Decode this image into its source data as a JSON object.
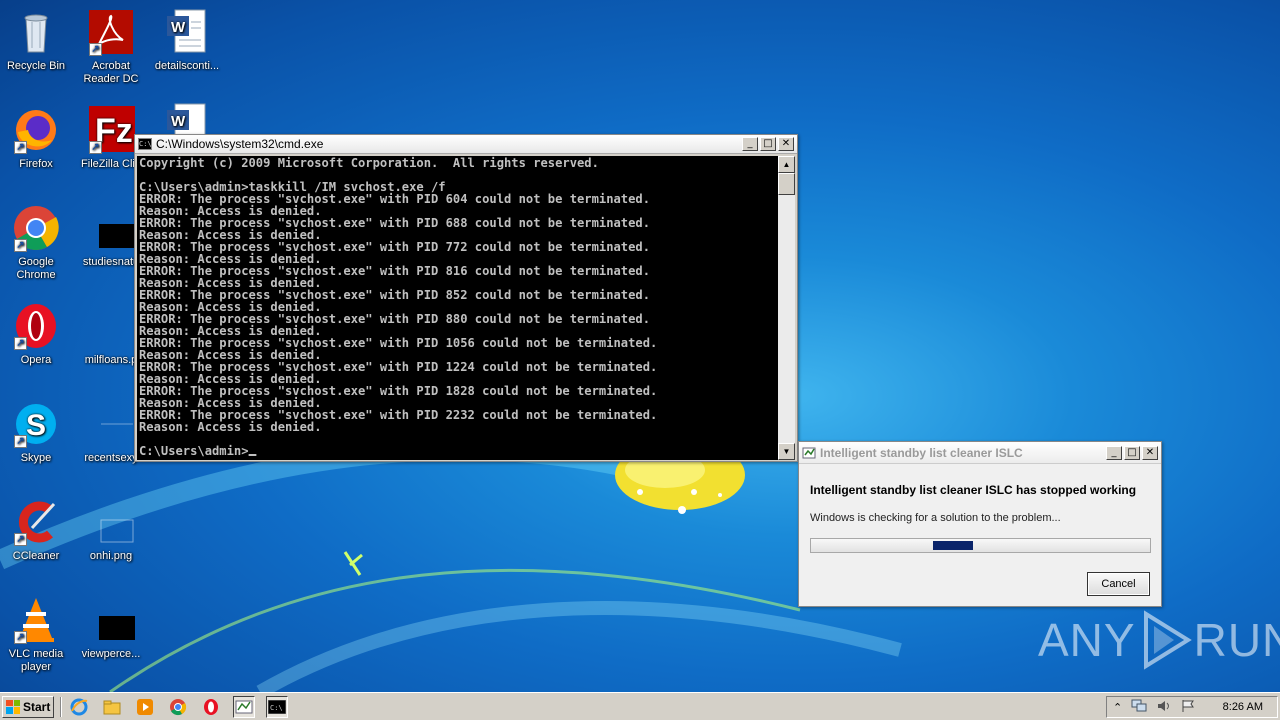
{
  "desktop": {
    "icons": [
      {
        "label": "Recycle Bin",
        "icon": "recycle-bin-icon"
      },
      {
        "label": "Acrobat Reader DC",
        "icon": "acrobat-icon"
      },
      {
        "label": "detailsconti...",
        "icon": "word-doc-icon"
      },
      {
        "label": "Firefox",
        "icon": "firefox-icon"
      },
      {
        "label": "FileZilla Clie",
        "icon": "filezilla-icon"
      },
      {
        "label": "Google Chrome",
        "icon": "chrome-icon"
      },
      {
        "label": "studiesnatu",
        "icon": "file-icon"
      },
      {
        "label": "Opera",
        "icon": "opera-icon"
      },
      {
        "label": "milfloans.p",
        "icon": "file-icon"
      },
      {
        "label": "Skype",
        "icon": "skype-icon"
      },
      {
        "label": "recentsexy",
        "icon": "file-icon"
      },
      {
        "label": "CCleaner",
        "icon": "ccleaner-icon"
      },
      {
        "label": "onhi.png",
        "icon": "image-file-icon"
      },
      {
        "label": "VLC media player",
        "icon": "vlc-icon"
      },
      {
        "label": "viewperce...",
        "icon": "file-icon"
      }
    ]
  },
  "cmd_window": {
    "title": "C:\\Windows\\system32\\cmd.exe",
    "lines": [
      "Copyright (c) 2009 Microsoft Corporation.  All rights reserved.",
      "",
      "C:\\Users\\admin>taskkill /IM svchost.exe /f",
      "ERROR: The process \"svchost.exe\" with PID 604 could not be terminated.",
      "Reason: Access is denied.",
      "ERROR: The process \"svchost.exe\" with PID 688 could not be terminated.",
      "Reason: Access is denied.",
      "ERROR: The process \"svchost.exe\" with PID 772 could not be terminated.",
      "Reason: Access is denied.",
      "ERROR: The process \"svchost.exe\" with PID 816 could not be terminated.",
      "Reason: Access is denied.",
      "ERROR: The process \"svchost.exe\" with PID 852 could not be terminated.",
      "Reason: Access is denied.",
      "ERROR: The process \"svchost.exe\" with PID 880 could not be terminated.",
      "Reason: Access is denied.",
      "ERROR: The process \"svchost.exe\" with PID 1056 could not be terminated.",
      "Reason: Access is denied.",
      "ERROR: The process \"svchost.exe\" with PID 1224 could not be terminated.",
      "Reason: Access is denied.",
      "ERROR: The process \"svchost.exe\" with PID 1828 could not be terminated.",
      "Reason: Access is denied.",
      "ERROR: The process \"svchost.exe\" with PID 2232 could not be terminated.",
      "Reason: Access is denied.",
      ""
    ],
    "prompt": "C:\\Users\\admin>"
  },
  "error_dialog": {
    "title": "Intelligent standby list cleaner ISLC",
    "heading": "Intelligent standby list cleaner ISLC has stopped working",
    "message": "Windows is checking for a solution to the problem...",
    "cancel_label": "Cancel"
  },
  "watermark": {
    "left": "ANY",
    "right": "RUN"
  },
  "taskbar": {
    "start_label": "Start",
    "quick_launch": [
      "ie-icon",
      "explorer-icon",
      "media-player-icon",
      "chrome-icon",
      "opera-icon",
      "islc-icon",
      "cmd-icon"
    ],
    "clock": "8:26 AM"
  },
  "colors": {
    "cmd_bg": "#000000",
    "cmd_text": "#c0c0c0",
    "progress": "#0a246a",
    "taskbar": "#d4d0c8"
  }
}
